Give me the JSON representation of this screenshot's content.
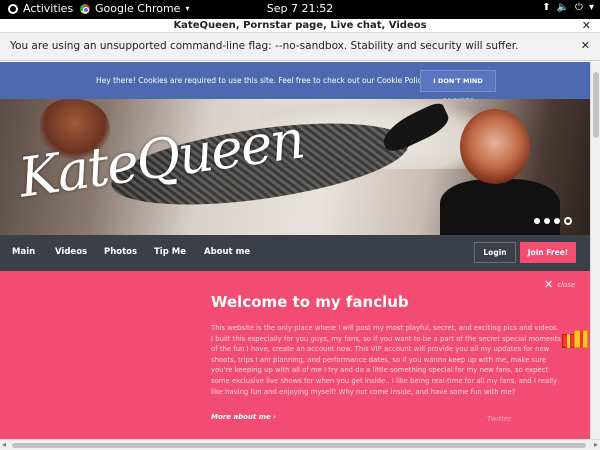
{
  "system_bar": {
    "activities": "Activities",
    "app_name": "Google Chrome",
    "clock": "Sep 7  21:52",
    "tray_icons": [
      "network-icon",
      "volume-icon",
      "power-icon"
    ]
  },
  "window": {
    "title": "KateQueen, Pornstar page, Live chat, Videos"
  },
  "infobar": {
    "message": "You are using an unsupported command-line flag: --no-sandbox. Stability and security will suffer."
  },
  "cookie_banner": {
    "message": "Hey there! Cookies are required to use this site. Feel free to check out our Cookie Policy at any time.",
    "button": "I DON'T MIND COOKIES",
    "bg_color": "#4f69b0"
  },
  "hero": {
    "logo": "KateQueen",
    "slides": 4,
    "active_slide": 4
  },
  "nav": {
    "items": [
      {
        "label": "Main"
      },
      {
        "label": "Videos"
      },
      {
        "label": "Photos"
      },
      {
        "label": "Tip Me"
      },
      {
        "label": "About me"
      }
    ],
    "login": "Login",
    "join": "Join Free!",
    "accent_color": "#f44d72"
  },
  "fanclub": {
    "close_label": "close",
    "title": "Welcome to my fanclub",
    "body": "This website is the only place where I will post my most playful, secret, and exciting pics and videos. I built this especially for you guys, my fans, so if you want to be a part of the secret special moments of the fun I have, create an account now. This VIP account will provide you all my updates for new shoots, trips I am planning, and performance dates, so if you wanna keep up with me, make sure you're keeping up with all of me I try and do a little something special for my new fans, so expect some exclusive live shows for when you get inside.. I like being real-time for all my fans, and I really like having fun and enjoying myself! Why not come inside, and have some fun with me?",
    "more_link": "More about me",
    "twitter": "Twitter",
    "bg_color": "#f34c72"
  }
}
